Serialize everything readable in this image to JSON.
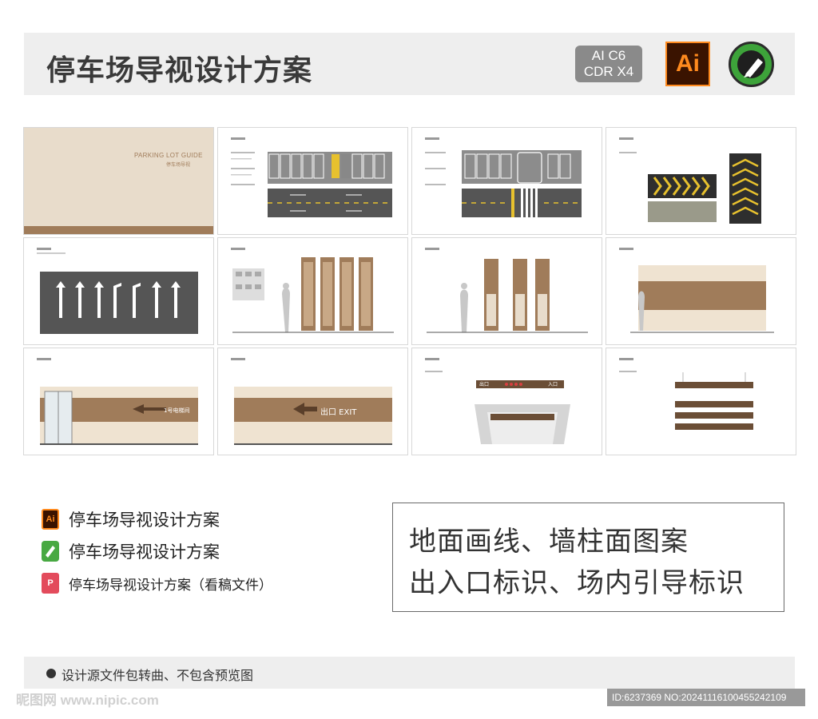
{
  "header": {
    "title": "停车场导视设计方案",
    "version_line1": "AI C6",
    "version_line2": "CDR X4",
    "ai_icon_text": "Ai",
    "ai_icon": "adobe-illustrator-icon",
    "cdr_icon": "coreldraw-icon"
  },
  "cover": {
    "en_title": "PARKING LOT GUIDE",
    "cn_title": "停车场导视"
  },
  "tiles": {
    "t5_arrow_labels": "",
    "t9_sign_text": "1号电梯间",
    "t10_exit_text": "出口 EXIT",
    "t11_gate_text": "出口",
    "t11_gate_enter": "入口"
  },
  "files": [
    {
      "icon": "ai-file-icon",
      "icon_text": "Ai",
      "label": "停车场导视设计方案"
    },
    {
      "icon": "cdr-file-icon",
      "icon_text": "",
      "label": "停车场导视设计方案"
    },
    {
      "icon": "pdf-file-icon",
      "icon_text": "P",
      "label": "停车场导视设计方案（看稿文件）"
    }
  ],
  "description": {
    "line1": "地面画线、墙柱面图案",
    "line2": "出入口标识、场内引导标识"
  },
  "footer": {
    "note": "设计源文件包转曲、不包含预览图"
  },
  "watermark": {
    "site": "昵图网 www.nipic.com",
    "id_text": "ID:6237369 NO:20241116100455242109"
  },
  "colors": {
    "brand_brown": "#a07c5a",
    "cream": "#e8dccb",
    "road_gray": "#5a5a5a",
    "ai_orange": "#ff8a1e",
    "cdr_green": "#3da33a"
  }
}
